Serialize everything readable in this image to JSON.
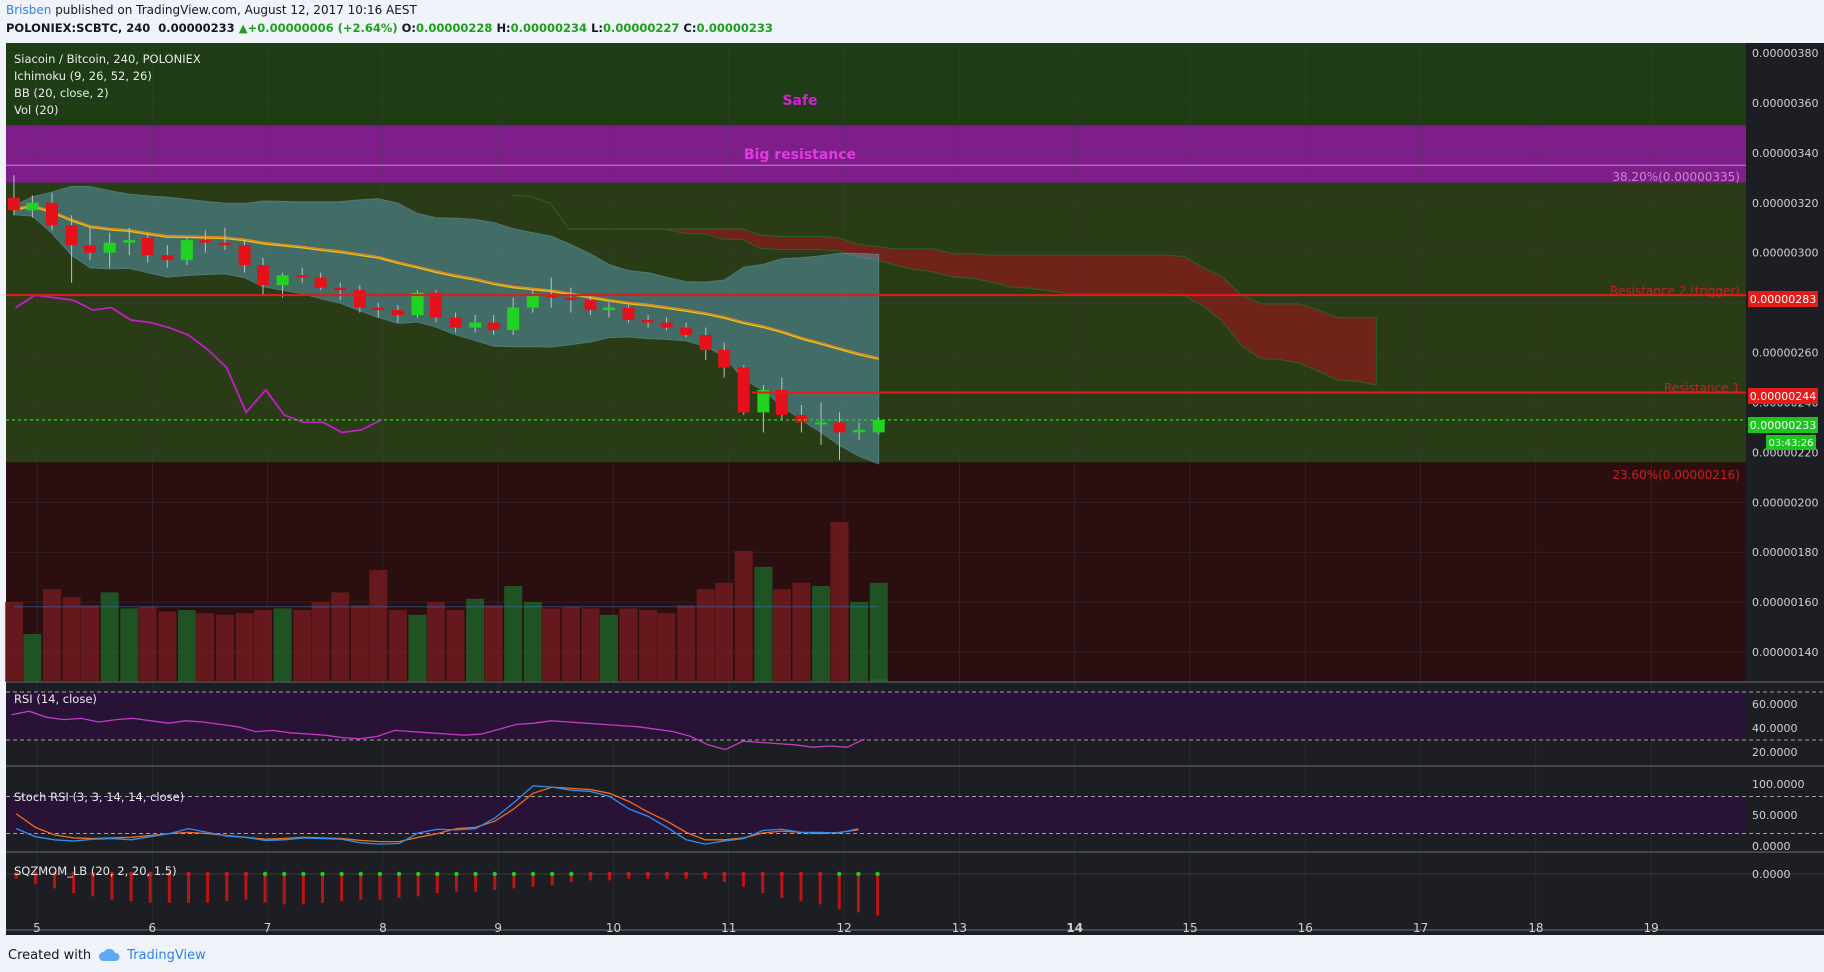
{
  "header": {
    "author": "Brisben",
    "published": "published on TradingView.com, August 12, 2017 10:16 AEST",
    "symbol": "POLONIEX:SCBTC, 240",
    "last": "0.00000233",
    "change": "+0.00000006 (+2.64%)",
    "o_label": "O:",
    "o_value": "0.00000228",
    "h_label": "H:",
    "h_value": "0.00000234",
    "l_label": "L:",
    "l_value": "0.00000227",
    "c_label": "C:",
    "c_value": "0.00000233"
  },
  "legend": {
    "line1": "Siacoin / Bitcoin, 240, POLONIEX",
    "line2": "Ichimoku (9, 26, 52, 26)",
    "line3": "BB (20, close, 2)",
    "line4": "Vol (20)"
  },
  "annotations": {
    "safe": "Safe",
    "big_resistance": "Big resistance",
    "fib382": "38.20%(0.00000335)",
    "fib236": "23.60%(0.00000216)",
    "res2": "Resistance 2 (trigger)",
    "res1": "Resistance 1"
  },
  "price_tags": {
    "res2": "0.00000283",
    "res1": "0.00000244",
    "last": "0.00000233",
    "countdown": "03:43:26"
  },
  "panes": {
    "rsi": "RSI (14, close)",
    "stoch": "Stoch RSI (3, 3, 14, 14, close)",
    "sqz": "SQZMOM_LB (20, 2, 20, 1.5)"
  },
  "footer": {
    "created": "Created with",
    "brand": "TradingView"
  },
  "colors": {
    "up": "#21d321",
    "down": "#e4111b",
    "bg_dark": "#1c1e24",
    "safe_zone": "#1f3d14",
    "resistance_band": "#8b1e97",
    "danger_zone": "#2b0f10",
    "rsi_line": "#c23ac9",
    "stoch_k": "#2e8ff0",
    "stoch_d": "#f26a1b"
  },
  "chart_data": {
    "type": "candlestick",
    "title": "Siacoin / Bitcoin, 240, POLONIEX",
    "x_ticks": [
      "5",
      "6",
      "7",
      "8",
      "9",
      "10",
      "11",
      "12",
      "13",
      "14",
      "15",
      "16",
      "17",
      "18",
      "19"
    ],
    "y_ticks": [
      "0.00000380",
      "0.00000360",
      "0.00000340",
      "0.00000320",
      "0.00000300",
      "0.00000280",
      "0.00000260",
      "0.00000240",
      "0.00000220",
      "0.00000200",
      "0.00000180",
      "0.00000160",
      "0.00000140"
    ],
    "ylim": [
      1.28e-06,
      3.84e-06
    ],
    "levels": {
      "big_resistance": [
        3.28e-06,
        3.51e-06
      ],
      "fib_382": 3.35e-06,
      "fib_236": 2.16e-06,
      "resistance_2": 2.83e-06,
      "resistance_1": 2.44e-06,
      "last_price": 2.33e-06
    },
    "candles": [
      {
        "t": 4.8,
        "o": 3.22e-06,
        "h": 3.31e-06,
        "l": 3.15e-06,
        "c": 3.17e-06
      },
      {
        "t": 4.96,
        "o": 3.17e-06,
        "h": 3.23e-06,
        "l": 3.14e-06,
        "c": 3.2e-06
      },
      {
        "t": 5.13,
        "o": 3.2e-06,
        "h": 3.24e-06,
        "l": 3.09e-06,
        "c": 3.11e-06
      },
      {
        "t": 5.3,
        "o": 3.11e-06,
        "h": 3.15e-06,
        "l": 2.88e-06,
        "c": 3.03e-06
      },
      {
        "t": 5.46,
        "o": 3.03e-06,
        "h": 3.1e-06,
        "l": 2.97e-06,
        "c": 3e-06
      },
      {
        "t": 5.63,
        "o": 3e-06,
        "h": 3.08e-06,
        "l": 2.94e-06,
        "c": 3.04e-06
      },
      {
        "t": 5.8,
        "o": 3.04e-06,
        "h": 3.1e-06,
        "l": 2.99e-06,
        "c": 3.05e-06
      },
      {
        "t": 5.96,
        "o": 3.06e-06,
        "h": 3.08e-06,
        "l": 2.96e-06,
        "c": 2.99e-06
      },
      {
        "t": 6.13,
        "o": 2.99e-06,
        "h": 3.03e-06,
        "l": 2.94e-06,
        "c": 2.97e-06
      },
      {
        "t": 6.3,
        "o": 2.97e-06,
        "h": 3.06e-06,
        "l": 2.95e-06,
        "c": 3.05e-06
      },
      {
        "t": 6.46,
        "o": 3.05e-06,
        "h": 3.09e-06,
        "l": 3e-06,
        "c": 3.04e-06
      },
      {
        "t": 6.63,
        "o": 3.04e-06,
        "h": 3.1e-06,
        "l": 3.01e-06,
        "c": 3.03e-06
      },
      {
        "t": 6.8,
        "o": 3.03e-06,
        "h": 3.05e-06,
        "l": 2.92e-06,
        "c": 2.95e-06
      },
      {
        "t": 6.96,
        "o": 2.95e-06,
        "h": 2.98e-06,
        "l": 2.83e-06,
        "c": 2.87e-06
      },
      {
        "t": 7.13,
        "o": 2.87e-06,
        "h": 2.92e-06,
        "l": 2.82e-06,
        "c": 2.91e-06
      },
      {
        "t": 7.3,
        "o": 2.91e-06,
        "h": 2.94e-06,
        "l": 2.88e-06,
        "c": 2.9e-06
      },
      {
        "t": 7.46,
        "o": 2.9e-06,
        "h": 2.92e-06,
        "l": 2.85e-06,
        "c": 2.86e-06
      },
      {
        "t": 7.63,
        "o": 2.86e-06,
        "h": 2.88e-06,
        "l": 2.81e-06,
        "c": 2.85e-06
      },
      {
        "t": 7.8,
        "o": 2.85e-06,
        "h": 2.87e-06,
        "l": 2.76e-06,
        "c": 2.78e-06
      },
      {
        "t": 7.96,
        "o": 2.78e-06,
        "h": 2.8e-06,
        "l": 2.74e-06,
        "c": 2.77e-06
      },
      {
        "t": 8.13,
        "o": 2.77e-06,
        "h": 2.79e-06,
        "l": 2.72e-06,
        "c": 2.75e-06
      },
      {
        "t": 8.3,
        "o": 2.75e-06,
        "h": 2.85e-06,
        "l": 2.74e-06,
        "c": 2.84e-06
      },
      {
        "t": 8.46,
        "o": 2.84e-06,
        "h": 2.85e-06,
        "l": 2.72e-06,
        "c": 2.74e-06
      },
      {
        "t": 8.63,
        "o": 2.74e-06,
        "h": 2.76e-06,
        "l": 2.68e-06,
        "c": 2.7e-06
      },
      {
        "t": 8.8,
        "o": 2.7e-06,
        "h": 2.75e-06,
        "l": 2.68e-06,
        "c": 2.72e-06
      },
      {
        "t": 8.96,
        "o": 2.72e-06,
        "h": 2.75e-06,
        "l": 2.67e-06,
        "c": 2.69e-06
      },
      {
        "t": 9.13,
        "o": 2.69e-06,
        "h": 2.82e-06,
        "l": 2.67e-06,
        "c": 2.78e-06
      },
      {
        "t": 9.3,
        "o": 2.78e-06,
        "h": 2.85e-06,
        "l": 2.76e-06,
        "c": 2.83e-06
      },
      {
        "t": 9.46,
        "o": 2.83e-06,
        "h": 2.9e-06,
        "l": 2.78e-06,
        "c": 2.82e-06
      },
      {
        "t": 9.63,
        "o": 2.82e-06,
        "h": 2.86e-06,
        "l": 2.76e-06,
        "c": 2.81e-06
      },
      {
        "t": 9.8,
        "o": 2.81e-06,
        "h": 2.83e-06,
        "l": 2.75e-06,
        "c": 2.77e-06
      },
      {
        "t": 9.96,
        "o": 2.77e-06,
        "h": 2.8e-06,
        "l": 2.74e-06,
        "c": 2.78e-06
      },
      {
        "t": 10.13,
        "o": 2.78e-06,
        "h": 2.79e-06,
        "l": 2.72e-06,
        "c": 2.73e-06
      },
      {
        "t": 10.3,
        "o": 2.73e-06,
        "h": 2.75e-06,
        "l": 2.7e-06,
        "c": 2.72e-06
      },
      {
        "t": 10.46,
        "o": 2.72e-06,
        "h": 2.74e-06,
        "l": 2.69e-06,
        "c": 2.7e-06
      },
      {
        "t": 10.63,
        "o": 2.7e-06,
        "h": 2.72e-06,
        "l": 2.66e-06,
        "c": 2.67e-06
      },
      {
        "t": 10.8,
        "o": 2.67e-06,
        "h": 2.7e-06,
        "l": 2.57e-06,
        "c": 2.61e-06
      },
      {
        "t": 10.96,
        "o": 2.61e-06,
        "h": 2.64e-06,
        "l": 2.5e-06,
        "c": 2.54e-06
      },
      {
        "t": 11.13,
        "o": 2.54e-06,
        "h": 2.55e-06,
        "l": 2.35e-06,
        "c": 2.36e-06
      },
      {
        "t": 11.3,
        "o": 2.36e-06,
        "h": 2.47e-06,
        "l": 2.28e-06,
        "c": 2.45e-06
      },
      {
        "t": 11.46,
        "o": 2.45e-06,
        "h": 2.5e-06,
        "l": 2.33e-06,
        "c": 2.35e-06
      },
      {
        "t": 11.63,
        "o": 2.35e-06,
        "h": 2.39e-06,
        "l": 2.28e-06,
        "c": 2.32e-06
      },
      {
        "t": 11.8,
        "o": 2.32e-06,
        "h": 2.4e-06,
        "l": 2.23e-06,
        "c": 2.32e-06
      },
      {
        "t": 11.96,
        "o": 2.32e-06,
        "h": 2.36e-06,
        "l": 2.17e-06,
        "c": 2.28e-06
      },
      {
        "t": 12.13,
        "o": 2.28e-06,
        "h": 2.32e-06,
        "l": 2.25e-06,
        "c": 2.29e-06
      },
      {
        "t": 12.3,
        "o": 2.28e-06,
        "h": 2.34e-06,
        "l": 2.27e-06,
        "c": 2.33e-06
      }
    ],
    "volume": [
      0.5,
      0.3,
      0.58,
      0.53,
      0.48,
      0.56,
      0.46,
      0.47,
      0.44,
      0.45,
      0.43,
      0.42,
      0.43,
      0.45,
      0.46,
      0.45,
      0.5,
      0.56,
      0.48,
      0.7,
      0.45,
      0.42,
      0.5,
      0.45,
      0.52,
      0.48,
      0.6,
      0.5,
      0.46,
      0.47,
      0.46,
      0.42,
      0.46,
      0.45,
      0.43,
      0.48,
      0.58,
      0.62,
      0.82,
      0.72,
      0.58,
      0.62,
      0.6,
      1.0,
      0.5,
      0.62,
      0.02
    ],
    "rsi": [
      51,
      54,
      49,
      47,
      48,
      45,
      47,
      48,
      46,
      44,
      46,
      45,
      43,
      41,
      37,
      38,
      36,
      35,
      34,
      32,
      31,
      33,
      38,
      37,
      36,
      35,
      34,
      35,
      39,
      43,
      44,
      46,
      45,
      44,
      43,
      42,
      41,
      39,
      37,
      33,
      26,
      22,
      29,
      28,
      27,
      26,
      24,
      25,
      24,
      31
    ],
    "stoch_k": [
      28,
      15,
      10,
      8,
      11,
      12,
      10,
      15,
      20,
      28,
      22,
      16,
      14,
      9,
      10,
      13,
      12,
      11,
      5,
      3,
      4,
      21,
      27,
      26,
      28,
      45,
      70,
      97,
      95,
      90,
      88,
      80,
      60,
      48,
      30,
      10,
      3,
      8,
      12,
      25,
      27,
      22,
      22,
      21,
      28
    ],
    "stoch_d": [
      52,
      30,
      18,
      13,
      12,
      13,
      14,
      17,
      20,
      22,
      20,
      17,
      14,
      11,
      12,
      14,
      13,
      12,
      9,
      7,
      7,
      14,
      20,
      28,
      30,
      40,
      60,
      85,
      95,
      93,
      91,
      85,
      72,
      55,
      40,
      22,
      10,
      10,
      13,
      21,
      24,
      22,
      20,
      22,
      26
    ],
    "sqz_signal": [
      0,
      0,
      0,
      0,
      0,
      0,
      0,
      0,
      0,
      0,
      0,
      0,
      0,
      1,
      1,
      1,
      1,
      1,
      1,
      1,
      1,
      1,
      1,
      1,
      1,
      1,
      1,
      1,
      1,
      1,
      0,
      0,
      0,
      0,
      0,
      0,
      0,
      0,
      0,
      0,
      0,
      0,
      0,
      1,
      1,
      1
    ],
    "sqz_hist": [
      3,
      6,
      9,
      12,
      14,
      16,
      17,
      18,
      18,
      18,
      18,
      17,
      16,
      18,
      19,
      19,
      18,
      17,
      16,
      16,
      15,
      14,
      12,
      11,
      11,
      10,
      9,
      8,
      7,
      5,
      4,
      4,
      3,
      3,
      3,
      3,
      3,
      5,
      8,
      12,
      15,
      17,
      19,
      22,
      24,
      26
    ]
  }
}
